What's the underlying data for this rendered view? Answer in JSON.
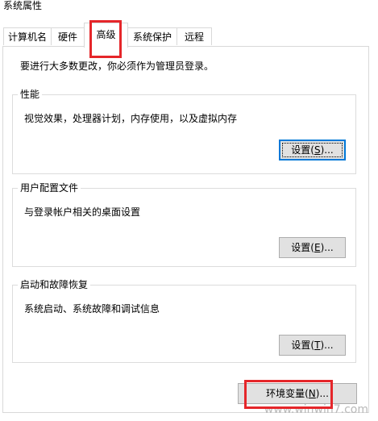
{
  "window": {
    "title": "系统属性"
  },
  "tabs": [
    {
      "label": "计算机名"
    },
    {
      "label": "硬件"
    },
    {
      "label": "高级"
    },
    {
      "label": "系统保护"
    },
    {
      "label": "远程"
    }
  ],
  "notice": "要进行大多数更改，你必须作为管理员登录。",
  "groups": {
    "performance": {
      "title": "性能",
      "description": "视觉效果，处理器计划，内存使用，以及虚拟内存",
      "button": {
        "prefix": "设置(",
        "accel": "S",
        "suffix": ")..."
      }
    },
    "profiles": {
      "title": "用户配置文件",
      "description": "与登录帐户相关的桌面设置",
      "button": {
        "prefix": "设置(",
        "accel": "E",
        "suffix": ")..."
      }
    },
    "startup": {
      "title": "启动和故障恢复",
      "description": "系统启动、系统故障和调试信息",
      "button": {
        "prefix": "设置(",
        "accel": "T",
        "suffix": ")..."
      }
    }
  },
  "env_button": {
    "prefix": "环境变量(",
    "accel": "N",
    "suffix": ")..."
  },
  "watermark": "www.winwin7.com",
  "colors": {
    "highlight": "#e5262a",
    "focus": "#0078d7"
  }
}
